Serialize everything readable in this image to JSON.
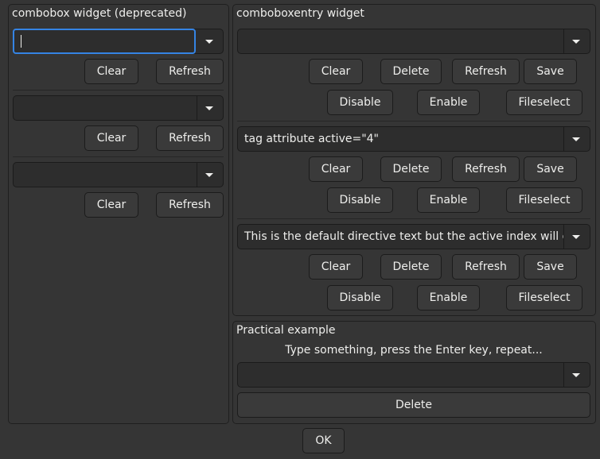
{
  "left": {
    "title": "combobox widget (deprecated)",
    "groups": [
      {
        "value": "",
        "clear": "Clear",
        "refresh": "Refresh"
      },
      {
        "value": "",
        "clear": "Clear",
        "refresh": "Refresh"
      },
      {
        "value": "",
        "clear": "Clear",
        "refresh": "Refresh"
      }
    ]
  },
  "right": {
    "title": "comboboxentry widget",
    "groups": [
      {
        "value": "",
        "clear": "Clear",
        "delete": "Delete",
        "refresh": "Refresh",
        "save": "Save",
        "disable": "Disable",
        "enable": "Enable",
        "fileselect": "Fileselect"
      },
      {
        "value": "tag attribute active=\"4\"",
        "clear": "Clear",
        "delete": "Delete",
        "refresh": "Refresh",
        "save": "Save",
        "disable": "Disable",
        "enable": "Enable",
        "fileselect": "Fileselect"
      },
      {
        "value": "This is the default directive text but the active index will ov",
        "clear": "Clear",
        "delete": "Delete",
        "refresh": "Refresh",
        "save": "Save",
        "disable": "Disable",
        "enable": "Enable",
        "fileselect": "Fileselect"
      }
    ]
  },
  "practical": {
    "title": "Practical example",
    "instruction": "Type something, press the Enter key, repeat...",
    "value": "",
    "delete": "Delete"
  },
  "ok": "OK",
  "colors": {
    "background": "#353535",
    "focus": "#3584e4",
    "entry": "#2d2d2d",
    "button": "#3a3a3a"
  }
}
